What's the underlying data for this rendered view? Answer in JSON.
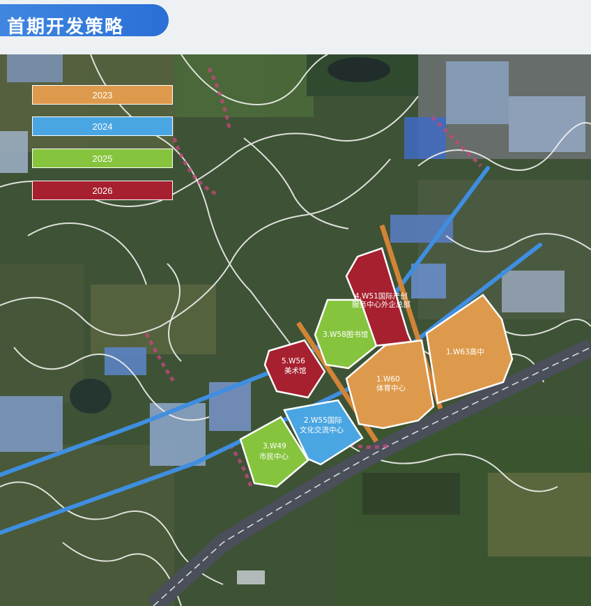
{
  "title": "首期开发策略",
  "legend": [
    {
      "year": "2023",
      "color": "#de9a4c"
    },
    {
      "year": "2024",
      "color": "#4aa6e2"
    },
    {
      "year": "2025",
      "color": "#86c43e"
    },
    {
      "year": "2026",
      "color": "#a6202f"
    }
  ],
  "parcels": [
    {
      "id": "w51",
      "line1": "4.W51国际产创",
      "line2": "服务中心外企总部",
      "year": "2026"
    },
    {
      "id": "w58",
      "line1": "3.W58图书馆",
      "line2": "",
      "year": "2025"
    },
    {
      "id": "w56",
      "line1": "5.W56",
      "line2": "美术馆",
      "year": "2026"
    },
    {
      "id": "w63",
      "line1": "1.W63高中",
      "line2": "",
      "year": "2023"
    },
    {
      "id": "w60",
      "line1": "1.W60",
      "line2": "体育中心",
      "year": "2023"
    },
    {
      "id": "w55",
      "line1": "2.W55国际",
      "line2": "文化交流中心",
      "year": "2024"
    },
    {
      "id": "w49",
      "line1": "3.W49",
      "line2": "市民中心",
      "year": "2025"
    }
  ]
}
